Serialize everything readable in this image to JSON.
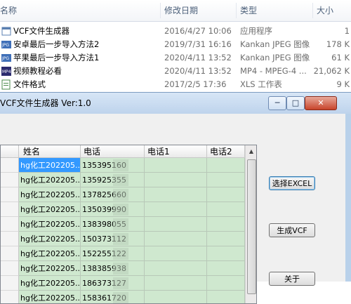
{
  "explorer": {
    "columns": {
      "name": "名称",
      "date": "修改日期",
      "type": "类型",
      "size": "大小"
    },
    "files": [
      {
        "name": "VCF文件生成器",
        "date": "2016/4/27 10:06",
        "type": "应用程序",
        "size": "1",
        "icon": "app-icon"
      },
      {
        "name": "安卓最后一步导入方法2",
        "date": "2019/7/31 16:16",
        "type": "Kankan JPEG 图像",
        "size": "178 K",
        "icon": "jpeg-icon"
      },
      {
        "name": "苹果最后一步导入方法1",
        "date": "2020/4/11 13:52",
        "type": "Kankan JPEG 图像",
        "size": "61 K",
        "icon": "jpeg-icon"
      },
      {
        "name": "视频教程必看",
        "date": "2020/4/11 13:52",
        "type": "MP4 - MPEG-4 ...",
        "size": "21,062 K",
        "icon": "mp4-icon"
      },
      {
        "name": "文件格式",
        "date": "2017/2/5 17:36",
        "type": "XLS 工作表",
        "size": "9 K",
        "icon": "xls-icon"
      }
    ]
  },
  "dialog": {
    "title": "VCF文件生成器 Ver:1.0",
    "minimize_label": "─",
    "maximize_label": "□",
    "close_label": "✕",
    "grid": {
      "headers": [
        "姓名",
        "电话",
        "电话1",
        "电话2"
      ],
      "rows": [
        {
          "name": "hg化工202205...",
          "phone": "135395160",
          "selected": true
        },
        {
          "name": "hg化工202205...",
          "phone": "135925355"
        },
        {
          "name": "hg化工202205...",
          "phone": "137825660"
        },
        {
          "name": "hg化工202205...",
          "phone": "135039990"
        },
        {
          "name": "hg化工202205...",
          "phone": "138398055"
        },
        {
          "name": "hg化工202205...",
          "phone": "150373112"
        },
        {
          "name": "hg化工202205...",
          "phone": "152255122"
        },
        {
          "name": "hg化工202205...",
          "phone": "138385938"
        },
        {
          "name": "hg化工202205...",
          "phone": "186373127"
        },
        {
          "name": "hg化工202205...",
          "phone": "158361720"
        }
      ]
    },
    "buttons": {
      "select_excel": "选择EXCEL",
      "generate_vcf": "生成VCF",
      "about": "关于"
    }
  }
}
